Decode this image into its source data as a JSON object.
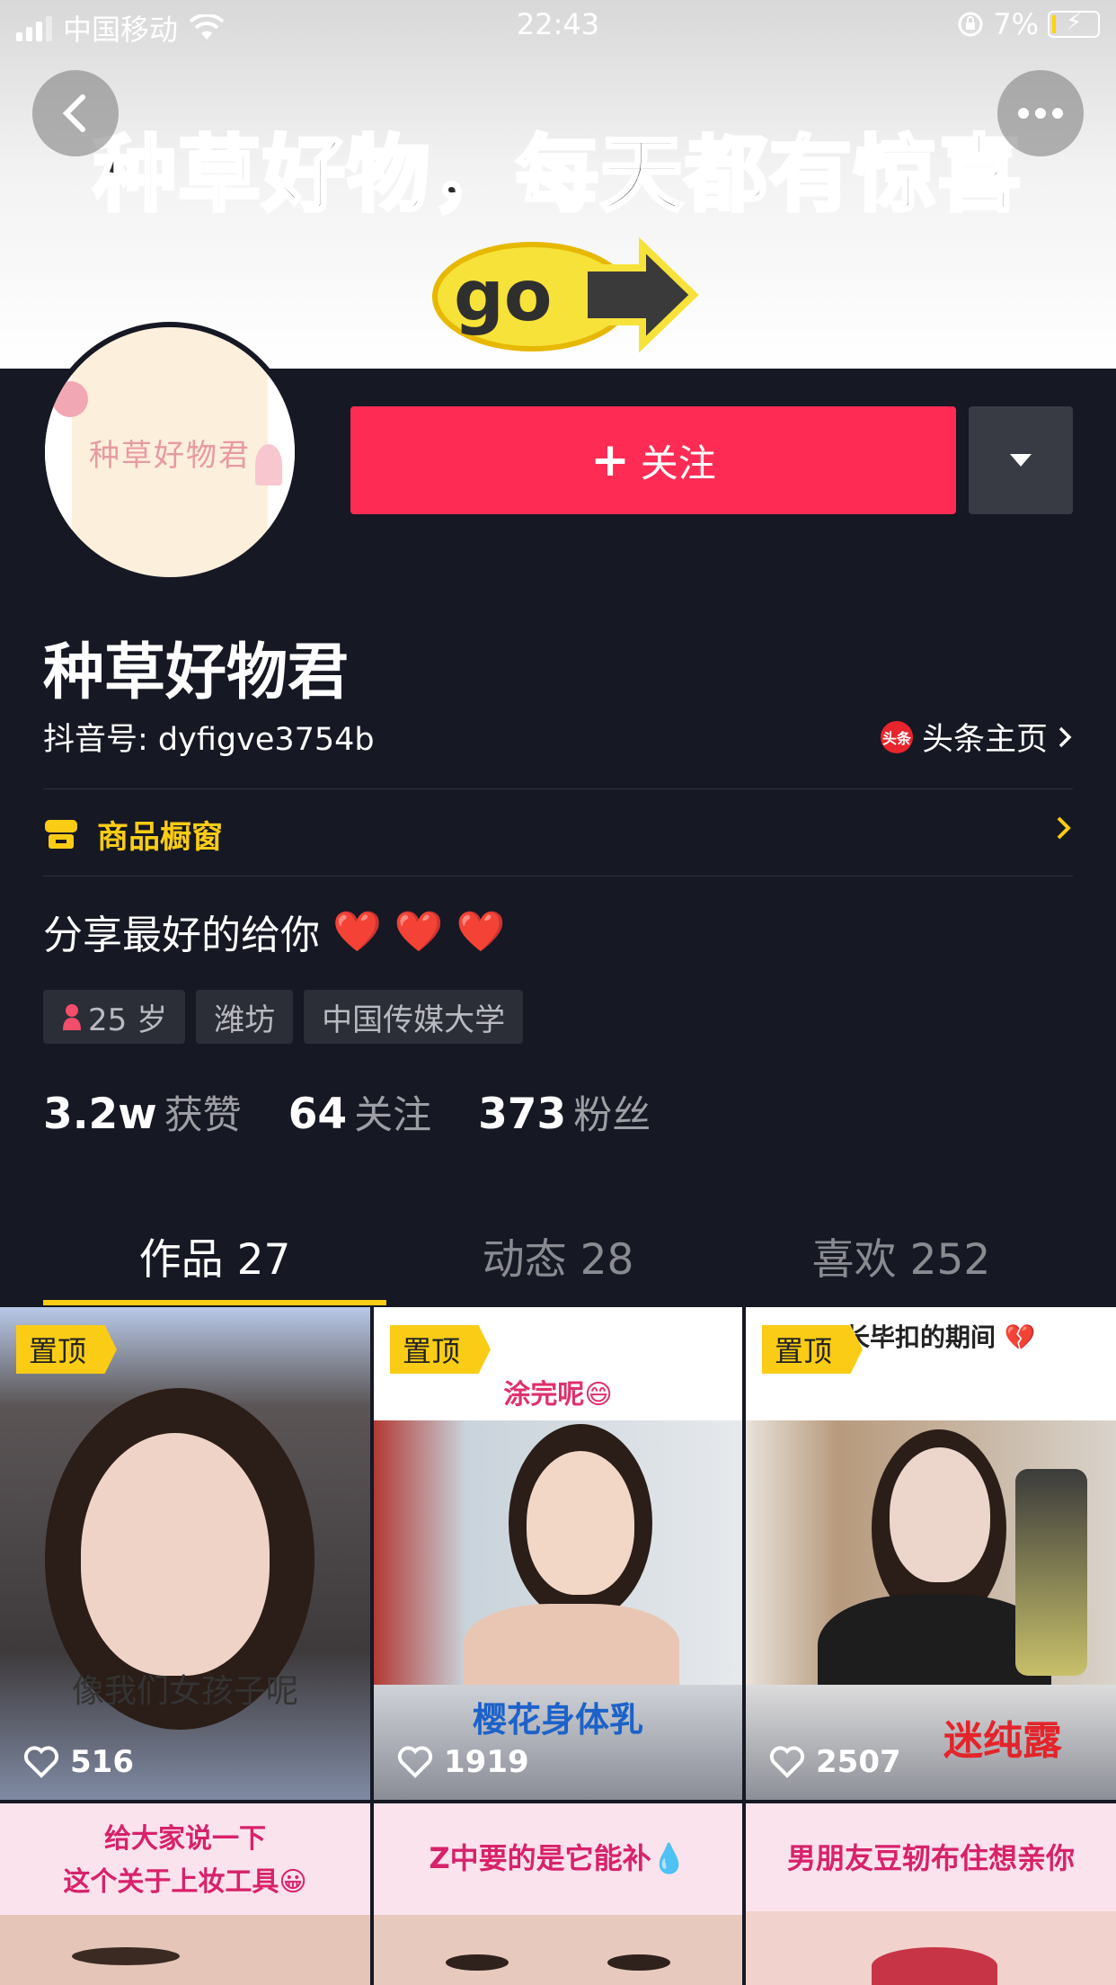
{
  "status_bar": {
    "carrier": "中国移动",
    "time": "22:43",
    "battery": "7%"
  },
  "banner": {
    "headline": "种草好物，每天都有惊喜",
    "sticker": "go"
  },
  "profile": {
    "avatar_text": "种草好物君",
    "follow_label": "关注",
    "name": "种草好物君",
    "douyin_id": "抖音号: dyfigve3754b",
    "toutiao_badge": "头条",
    "toutiao_link": "头条主页",
    "shop_label": "商品橱窗",
    "bio": "分享最好的给你",
    "bio_emoji": "❤️ ❤️ ❤️",
    "tags": {
      "age": "25 岁",
      "city": "潍坊",
      "school": "中国传媒大学"
    },
    "stats": {
      "likes_num": "3.2w",
      "likes_label": "获赞",
      "following_num": "64",
      "following_label": "关注",
      "fans_num": "373",
      "fans_label": "粉丝"
    }
  },
  "tabs": {
    "works": "作品 27",
    "moments": "动态 28",
    "liked": "喜欢 252"
  },
  "videos": [
    {
      "pin": "置顶",
      "likes": "516",
      "caption": "像我们女孩子呢"
    },
    {
      "pin": "置顶",
      "likes": "1919",
      "caption_top": "涂完呢😄",
      "caption": "樱花身体乳"
    },
    {
      "pin": "置顶",
      "likes": "2507",
      "caption_top": "长毕扣的期间 💔",
      "caption": "迷纯露"
    },
    {
      "caption_top": "给大家说一下",
      "caption_top2": "这个关于上妆工具😀"
    },
    {
      "caption_top": "Z中要的是它能补💧"
    },
    {
      "caption_top": "男朋友豆轫布住想亲你"
    }
  ],
  "colors": {
    "background": "#161823",
    "follow": "#fe2c55",
    "accent_yellow": "#facc15"
  }
}
